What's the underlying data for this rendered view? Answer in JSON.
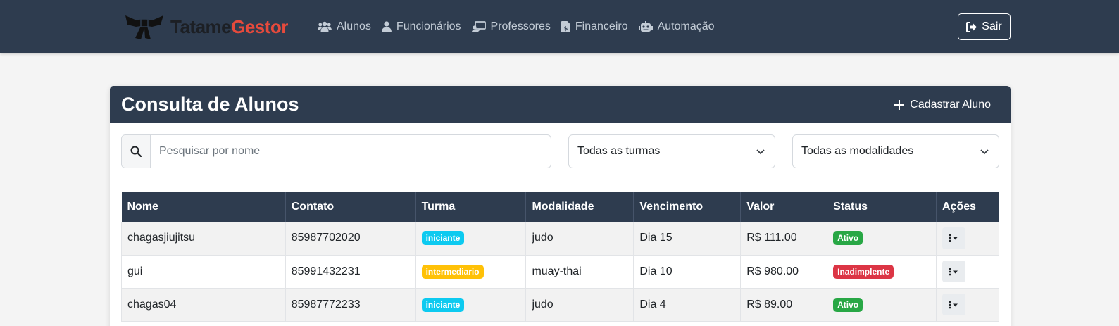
{
  "navbar": {
    "logo": {
      "part1": "Tatame",
      "part2": "Gestor"
    },
    "links": [
      {
        "label": "Alunos",
        "icon": "users-icon"
      },
      {
        "label": "Funcionários",
        "icon": "user-icon"
      },
      {
        "label": "Professores",
        "icon": "chalkboard-teacher-icon"
      },
      {
        "label": "Financeiro",
        "icon": "invoice-dollar-icon"
      },
      {
        "label": "Automação",
        "icon": "robot-icon"
      }
    ],
    "logout": {
      "label": "Sair",
      "icon": "sign-out-icon"
    }
  },
  "card": {
    "title": "Consulta de Alunos",
    "add_button": {
      "label": "Cadastrar Aluno",
      "icon": "plus-icon"
    }
  },
  "filters": {
    "search": {
      "placeholder": "Pesquisar por nome",
      "value": "",
      "icon": "search-icon"
    },
    "turma_select": {
      "value": "Todas as turmas"
    },
    "modalidade_select": {
      "value": "Todas as modalidades"
    }
  },
  "table": {
    "headers": [
      "Nome",
      "Contato",
      "Turma",
      "Modalidade",
      "Vencimento",
      "Valor",
      "Status",
      "Ações"
    ],
    "rows": [
      {
        "nome": "chagasjiujitsu",
        "contato": "85987702020",
        "turma": "iniciante",
        "modalidade": "judo",
        "vencimento": "Dia 15",
        "valor": "R$ 111.00",
        "status": "Ativo"
      },
      {
        "nome": "gui",
        "contato": "85991432231",
        "turma": "intermediario",
        "modalidade": "muay-thai",
        "vencimento": "Dia 10",
        "valor": "R$ 980.00",
        "status": "Inadimplente"
      },
      {
        "nome": "chagas04",
        "contato": "85987772233",
        "turma": "iniciante",
        "modalidade": "judo",
        "vencimento": "Dia 4",
        "valor": "R$ 89.00",
        "status": "Ativo"
      }
    ]
  },
  "colors": {
    "navbar_bg": "#2e3c4f",
    "brand_accent": "#e64a3c",
    "badge_iniciante": "#0dcaf0",
    "badge_intermediario": "#ffc107",
    "badge_ativo": "#28a745",
    "badge_inadimplente": "#dc3545"
  }
}
